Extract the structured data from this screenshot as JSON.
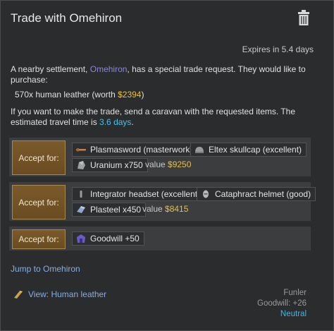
{
  "window": {
    "title": "Trade with Omehiron"
  },
  "expires": "Expires in 5.4 days",
  "description": {
    "part1": "A nearby settlement, ",
    "settlement": "Omehiron",
    "part2": ", has a special trade request. They would like to purchase:"
  },
  "request": {
    "text": "570x human leather (worth ",
    "worth": "$2394",
    "close": ")"
  },
  "instructions": {
    "part1": "If you want to make the trade, send a caravan with the requested items. The estimated travel time is ",
    "travel_time": "3.6 days",
    "part2": "."
  },
  "offers": [
    {
      "accept_label": "Accept for:",
      "items": [
        "Plasmasword (masterwork)",
        "Eltex skullcap (excellent)",
        "Uranium x750"
      ],
      "value_label": "value",
      "value": "$9250"
    },
    {
      "accept_label": "Accept for:",
      "items": [
        "Integrator headset (excellent)",
        "Cataphract helmet (good)",
        "Plasteel x450"
      ],
      "value_label": "value",
      "value": "$8415"
    },
    {
      "accept_label": "Accept for:",
      "items": [
        "Goodwill +50"
      ]
    }
  ],
  "jump_link": "Jump to Omehiron",
  "view_link": "View: Human leather",
  "faction": {
    "name": "Funler",
    "goodwill": "Goodwill: +26",
    "relation": "Neutral"
  },
  "icons": {
    "trash": "trash-icon",
    "plasmasword": "plasmasword-icon",
    "skullcap": "helmet-icon",
    "uranium": "uranium-icon",
    "headset": "headset-icon",
    "cataphract": "helmet-icon",
    "plasteel": "plasteel-icon",
    "goodwill": "goodwill-icon",
    "leather": "leather-icon"
  },
  "colors": {
    "accept_button": "#6a4c22",
    "gold": "#e8c040",
    "link": "#8aaedc",
    "neutral": "#3ab8e8",
    "settlement": "#8d86d6"
  }
}
